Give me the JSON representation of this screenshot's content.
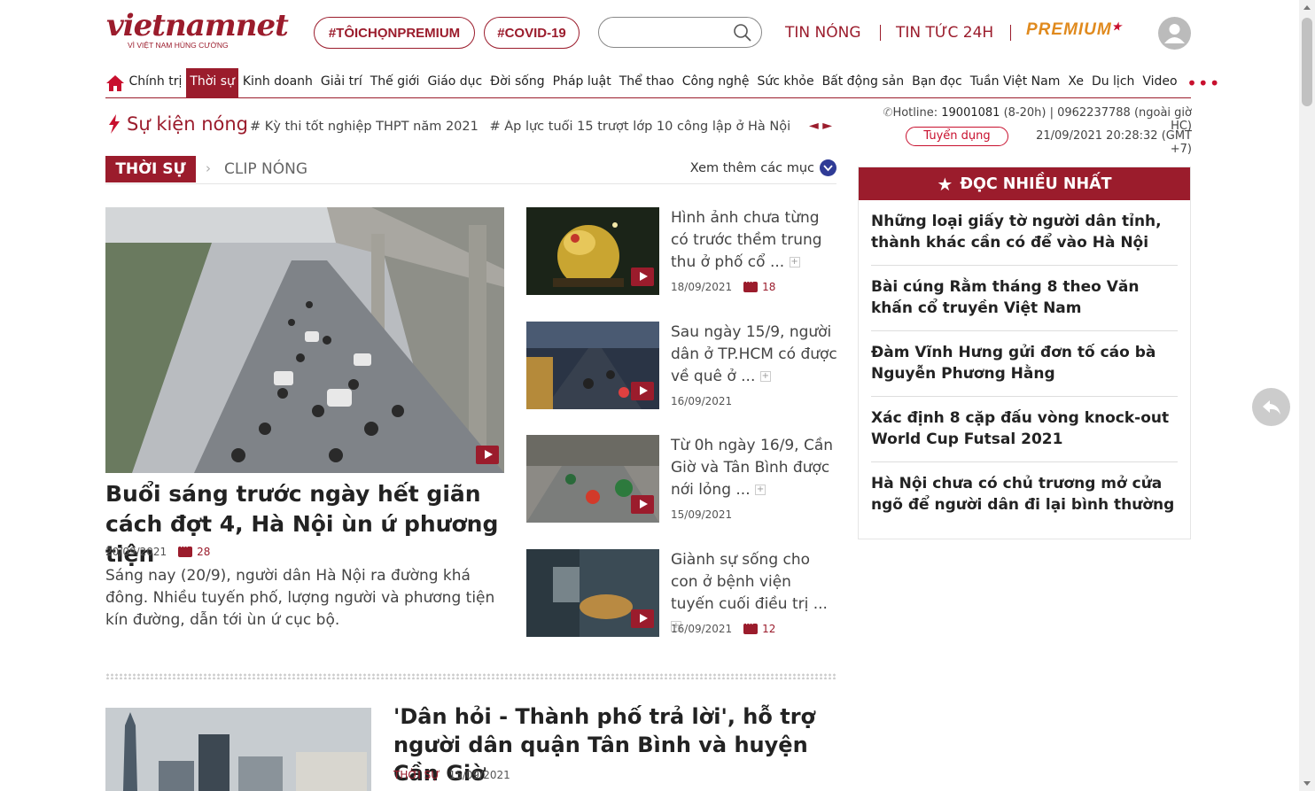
{
  "header": {
    "logo_text": "vietnamnet",
    "logo_tagline": "VÌ VIỆT NAM HÙNG CƯỜNG",
    "tag1": "#TÔICHỌNPREMIUM",
    "tag2": "#COVID-19",
    "search_placeholder": "",
    "link_hot": "TIN NÓNG",
    "link_24h": "TIN TỨC 24H",
    "premium": "PREMIUM"
  },
  "nav": {
    "items": [
      "Chính trị",
      "Thời sự",
      "Kinh doanh",
      "Giải trí",
      "Thế giới",
      "Giáo dục",
      "Đời sống",
      "Pháp luật",
      "Thể thao",
      "Công nghệ",
      "Sức khỏe",
      "Bất động sản",
      "Bạn đọc",
      "Tuần Việt Nam",
      "Xe",
      "Du lịch",
      "Video"
    ],
    "active": "Thời sự",
    "more": "•••"
  },
  "hot": {
    "title": "Sự kiện nóng",
    "items": [
      "# Kỳ thi tốt nghiệp THPT năm 2021",
      "# Áp lực tuổi 15 trượt lớp 10 công lập ở Hà Nội",
      "#"
    ],
    "arrows": "◄ ►"
  },
  "contact": {
    "hotline_label": "Hotline: ",
    "hotline_number": "19001081",
    "hotline_rest": " (8-20h) | 0962237788 (ngoài giờ HC)",
    "recruit": "Tuyển dụng",
    "datetime": "21/09/2021 20:28:32 (GMT +7)"
  },
  "section": {
    "tag": "THỜI SỰ",
    "chevron": "›",
    "sub": "CLIP NÓNG",
    "more": "Xem thêm các mục"
  },
  "lead": {
    "title": "Buổi sáng trước ngày hết giãn cách đợt 4, Hà Nội ùn ứ phương tiện",
    "date": "20/09/2021",
    "comments": "28",
    "sapo": "Sáng nay (20/9), người dân Hà Nội ra đường khá đông. Nhiều tuyến phố, lượng người và phương tiện kín đường, dẫn tới ùn ứ cục bộ."
  },
  "side": [
    {
      "title": "Hình ảnh chưa từng có trước thềm trung thu ở phố cổ ...",
      "date": "18/09/2021",
      "comments": "18"
    },
    {
      "title": "Sau ngày 15/9, người dân ở TP.HCM có được về quê ở ...",
      "date": "16/09/2021",
      "comments": ""
    },
    {
      "title": "Từ 0h ngày 16/9, Cần Giờ và Tân Bình được nới lỏng ...",
      "date": "15/09/2021",
      "comments": ""
    },
    {
      "title": "Giành sự sống cho con ở bệnh viện tuyến cuối điều trị ...",
      "date": "16/09/2021",
      "comments": "12"
    }
  ],
  "plus": "+",
  "article2": {
    "title": "'Dân hỏi - Thành phố trả lời', hỗ trợ người dân quận Tân Bình và huyện Cần Giờ",
    "category": "THỜI SỰ",
    "date": "15/09/2021"
  },
  "most_read": {
    "title": "ĐỌC NHIỀU NHẤT",
    "items": [
      "Những loại giấy tờ người dân tỉnh, thành khác cần có để vào Hà Nội",
      "Bài cúng Rằm tháng 8 theo Văn khấn cổ truyền Việt Nam",
      "Đàm Vĩnh Hưng gửi đơn tố cáo bà Nguyễn Phương Hằng",
      "Xác định 8 cặp đấu vòng knock-out World Cup Futsal 2021",
      "Hà Nội chưa có chủ trương mở cửa ngõ để người dân đi lại bình thường"
    ]
  },
  "colors": {
    "brand": "#9b1c2c",
    "accent": "#c8102e",
    "premium": "#e08a1e"
  }
}
